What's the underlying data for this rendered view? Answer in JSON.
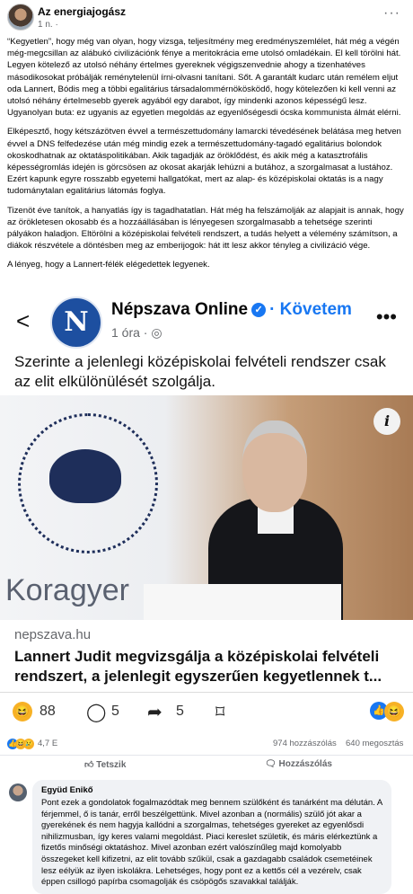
{
  "post": {
    "author": "Az energiajogász",
    "meta": "1 n. ·",
    "more": "···",
    "paragraphs": [
      "“Kegyetlen”, hogy még van olyan, hogy vizsga, teljesítmény meg eredményszemlélet, hát még a végén még-megcsillan az alábukó civilizációnk fénye a meritokrácia eme utolsó omladékain. El kell törölni hát. Legyen kötelező az utolsó néhány értelmes gyereknek végigszenvednie ahogy a tizenhatéves másodikosokat próbálják reménytelenül írni-olvasni tanítani. Sőt. A garantált kudarc után remélem eljut oda Lannert, Bódis meg a többi egalitárius társadalommérnökösködő, hogy kötelezően ki kell venni az utolsó néhány értelmesebb gyerek agyából egy darabot, így mindenki azonos képességű lesz. Ugyanolyan buta: ez ugyanis az egyetlen megoldás az egyenlőségesdi ócska kommunista álmát elérni.",
      "Elképesztő, hogy kétszázötven évvel a természettudomány lamarcki tévedésének belátása meg hetven évvel a DNS felfedezése után még mindig ezek a természettudomány-tagadó egalitárius bolondok okoskodhatnak az oktatáspolitikában. Akik tagadják az öröklődést, és akik még a katasztrofális képességromlás idején is görcsösen az okosat akarják lehúzni a butához, a szorgalmasat a lustához. Ezért kapunk egyre rosszabb egyetemi hallgatókat, mert az alap- és középiskolai oktatás is a nagy tudománytalan egalitárius látomás foglya.",
      "Tizenöt éve tanítok, a hanyatlás így is tagadhatatlan. Hát még ha felszámolják az alapjait is annak, hogy az örökletesen okosabb és a hozzáállásában is lényegesen szorgalmasabb a tehetsége szerinti pályákon haladjon. Eltörölni a középiskolai felvételi rendszert, a tudás helyett a vélemény számítson, a diákok részvétele a döntésben meg az emberijogok: hát itt lesz akkor tényleg a civilizáció vége.",
      "A lényeg, hogy a Lannert-félék elégedettek legyenek."
    ]
  },
  "shared": {
    "back": "<",
    "logo_letter": "N",
    "page_name": "Népszava Online",
    "verified": "✓",
    "follow": "· Követem",
    "time": "1 óra · ◎",
    "more": "•••",
    "caption": "Szerinte a jelenlegi középiskolai felvételi rendszer csak az elit elkülönülését szolgálja.",
    "photo_text": "Koragyer",
    "info": "i",
    "domain": "nepszava.hu",
    "headline": "Lannert Judit megvizsgálja a középiskolai felvételi rendszert, a jelenlegit egyszerűen kegyetlennek t...",
    "reactions_count": "88",
    "comments_count": "5",
    "shares_count": "5"
  },
  "stats": {
    "reactions": "4,7 E",
    "comments": "974 hozzászólás",
    "shares": "640 megosztás"
  },
  "actions": {
    "like": "Tetszik",
    "comment": "Hozzászólás"
  },
  "comment": {
    "name": "Együd Enikő",
    "text": "Pont ezek a gondolatok fogalmazódtak meg bennem szülőként és tanárként ma délután. A férjemmel, ő is tanár, erről beszélgettünk. Mivel azonban a (normális) szülő jót akar a gyerekének és nem hagyja kallódni a szorgalmas, tehetséges gyereket az egyenlősdi nihilizmusban, így keres valami megoldást. Piaci kereslet születik, és máris elérkeztünk a fizetős minőségi oktatáshoz. Mivel azonban ezért valószínűleg majd komolyabb összegeket kell kifizetni, az elit tovább szűkül, csak a gazdagabb családok csemetéinek lesz eélyük az ilyen iskolákra. Lehetséges, hogy pont ez a kettős cél a vezérelv, csak éppen csillogó papírba csomagolják és csöpögős szavakkal találják."
  },
  "colors": {
    "facebook_blue": "#1877f2",
    "reaction_yellow": "#f7b125"
  }
}
